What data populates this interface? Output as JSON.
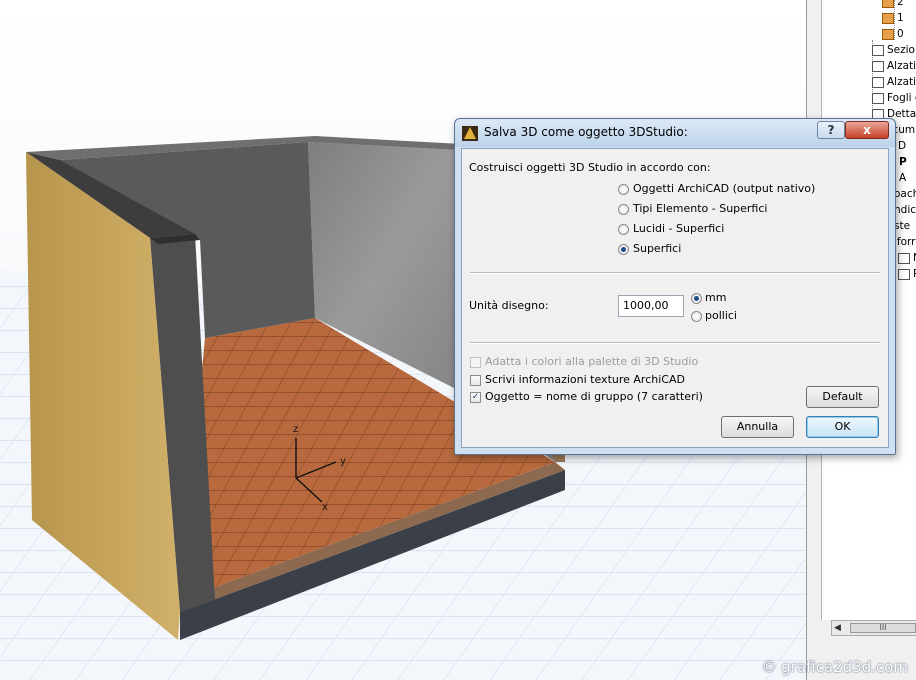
{
  "dialog": {
    "title": "Salva 3D come oggetto 3DStudio:",
    "help_label": "?",
    "close_label": "x",
    "build_label": "Costruisci oggetti 3D Studio in accordo con:",
    "build_options": [
      {
        "label": "Oggetti ArchiCAD (output nativo)",
        "selected": false
      },
      {
        "label": "Tipi Elemento - Superfici",
        "selected": false
      },
      {
        "label": "Lucidi - Superfici",
        "selected": false
      },
      {
        "label": "Superfici",
        "selected": true
      }
    ],
    "units_label": "Unità disegno:",
    "units_value": "1000,00",
    "unit_options": [
      {
        "label": "mm",
        "selected": true
      },
      {
        "label": "pollici",
        "selected": false
      }
    ],
    "checkboxes": [
      {
        "label": "Adatta i colori alla palette di 3D Studio",
        "checked": false,
        "enabled": false
      },
      {
        "label": "Scrivi informazioni texture ArchiCAD",
        "checked": false,
        "enabled": true
      },
      {
        "label": "Oggetto = nome di gruppo (7 caratteri)",
        "checked": true,
        "enabled": true
      }
    ],
    "default_button": "Default",
    "cancel_button": "Annulla",
    "ok_button": "OK"
  },
  "axes": {
    "z": "z",
    "y": "y",
    "x": "x"
  },
  "navigator": {
    "items": [
      "2",
      "1",
      "0",
      "Sezio",
      "Alzati",
      "Alzati",
      "Fogli c",
      "Detta",
      "ocum",
      "D",
      "P",
      "A",
      "oach",
      "ndici",
      "ste",
      "iforr",
      "N",
      "R"
    ],
    "scroll_label": "III"
  },
  "watermark": "© grafica2d3d.com",
  "colors": {
    "floor": "#b5643a",
    "wall_concrete": "#8f8f8f",
    "wall_dark": "#575757",
    "wall_yellow": "#c9a85a",
    "grid": "#c6d6ea"
  }
}
